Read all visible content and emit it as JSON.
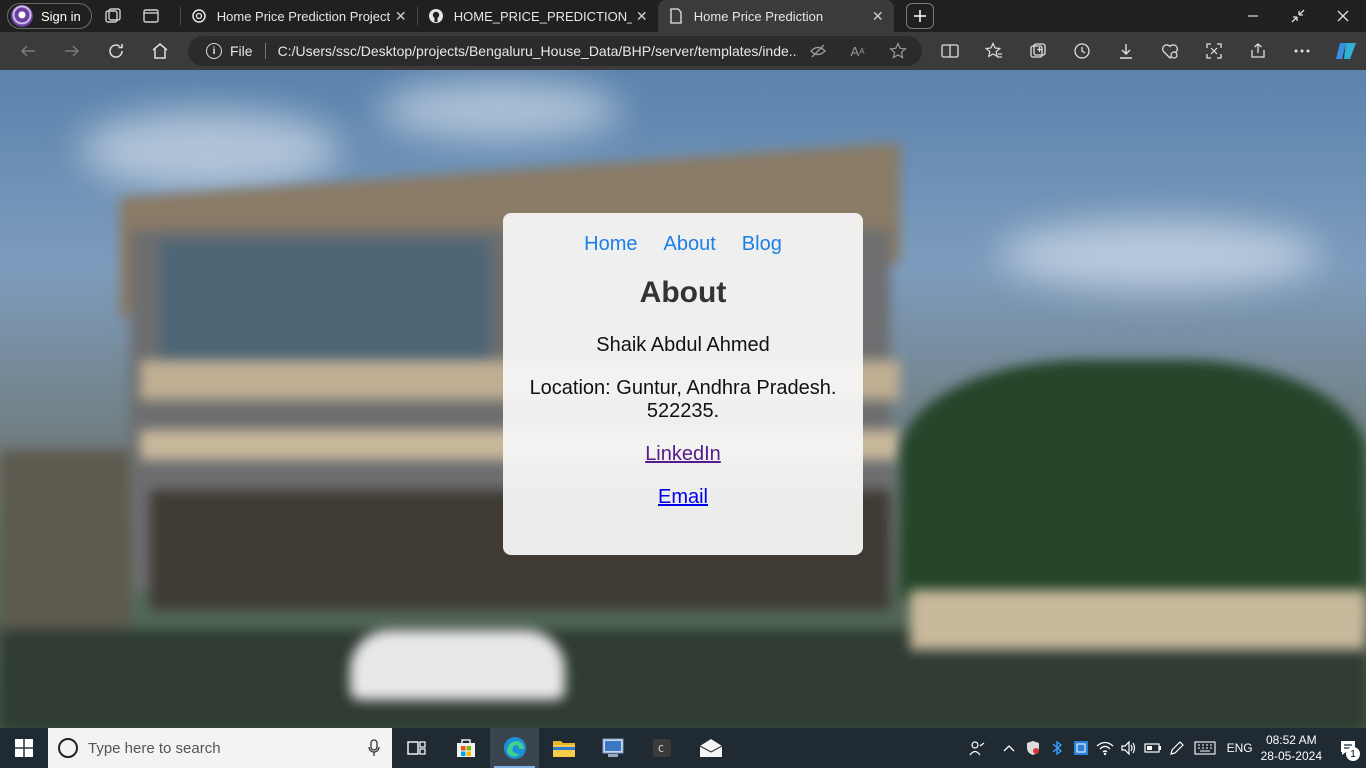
{
  "browser": {
    "profile": {
      "label": "Sign in"
    },
    "tabs": [
      {
        "title": "Home Price Prediction Project",
        "favicon": "openai-icon",
        "active": false
      },
      {
        "title": "HOME_PRICE_PREDICTION_PROJ",
        "favicon": "github-icon",
        "active": false
      },
      {
        "title": "Home Price Prediction",
        "favicon": "file-icon",
        "active": true
      }
    ],
    "address": {
      "scheme_label": "File",
      "url": "C:/Users/ssc/Desktop/projects/Bengaluru_House_Data/BHP/server/templates/inde..."
    }
  },
  "page": {
    "nav": {
      "home": "Home",
      "about": "About",
      "blog": "Blog"
    },
    "heading": "About",
    "name": "Shaik Abdul Ahmed",
    "location": "Location: Guntur, Andhra Pradesh. 522235.",
    "linkedin": "LinkedIn",
    "email": "Email"
  },
  "taskbar": {
    "search_placeholder": "Type here to search",
    "language": "ENG",
    "time": "08:52 AM",
    "date": "28-05-2024",
    "notification_count": "1"
  }
}
